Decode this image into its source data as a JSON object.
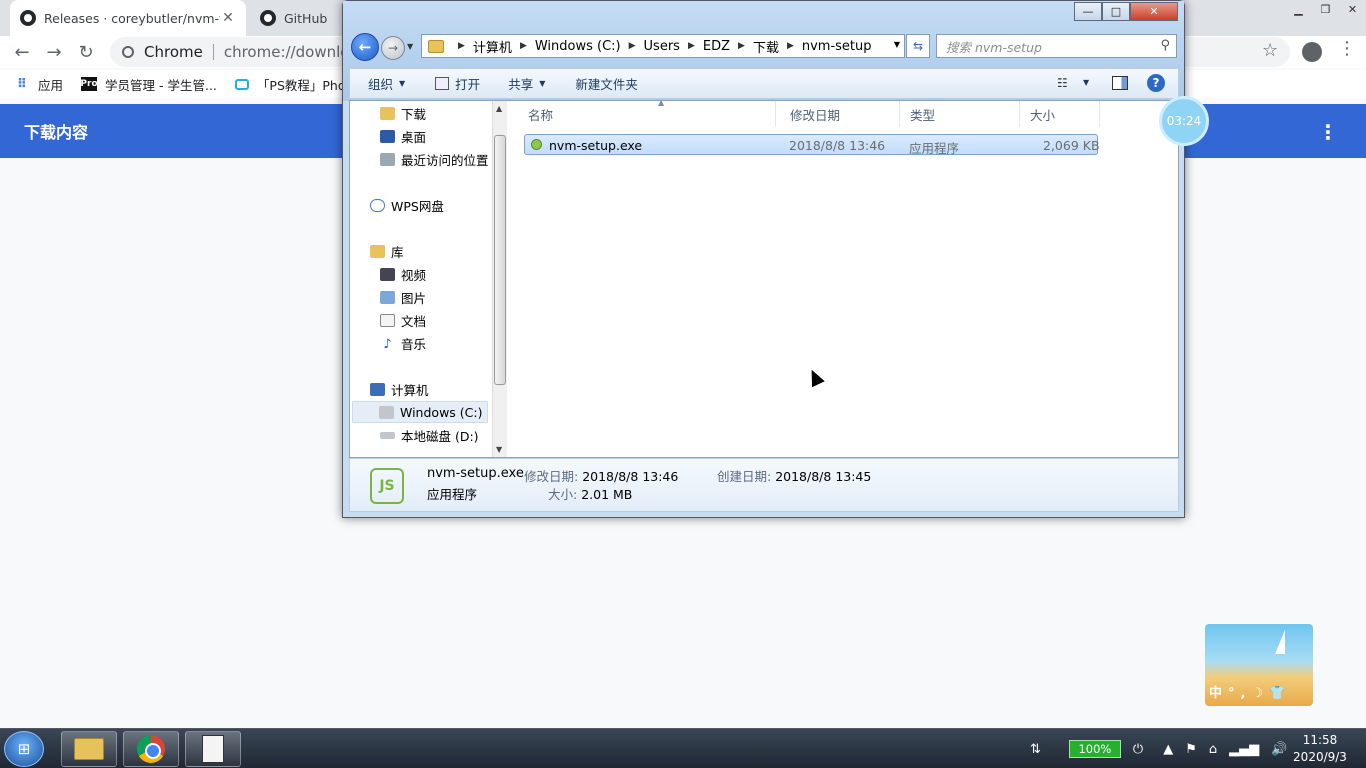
{
  "chrome": {
    "tabs": [
      {
        "title": "Releases · coreybutler/nvm-wi"
      },
      {
        "title": "GitHub - r"
      }
    ],
    "omnibox": {
      "label": "Chrome",
      "url": "chrome://downloads"
    },
    "bookmarks": [
      {
        "label": "应用",
        "icon": "apps-grid-icon"
      },
      {
        "label": "学员管理 - 学生管...",
        "icon": "pro-icon"
      },
      {
        "label": "「PS教程」Pho",
        "icon": "bilibili-icon"
      }
    ],
    "downloads_title": "下载内容"
  },
  "explorer": {
    "window_controls": {
      "min": "—",
      "max": "□",
      "close": "✕"
    },
    "breadcrumb": [
      "计算机",
      "Windows (C:)",
      "Users",
      "EDZ",
      "下载",
      "nvm-setup"
    ],
    "search_placeholder": "搜索 nvm-setup",
    "commands": {
      "organize": "组织",
      "open": "打开",
      "share": "共享",
      "new_folder": "新建文件夹"
    },
    "nav": {
      "downloads": "下载",
      "desktop": "桌面",
      "recent": "最近访问的位置",
      "wps": "WPS网盘",
      "library": "库",
      "video": "视频",
      "pictures": "图片",
      "documents": "文档",
      "music": "音乐",
      "computer": "计算机",
      "drive_c": "Windows (C:)",
      "drive_d": "本地磁盘 (D:)"
    },
    "columns": {
      "name": "名称",
      "modified": "修改日期",
      "type": "类型",
      "size": "大小"
    },
    "files": [
      {
        "name": "nvm-setup.exe",
        "modified": "2018/8/8 13:46",
        "type": "应用程序",
        "size": "2,069 KB"
      }
    ],
    "details": {
      "name": "nvm-setup.exe",
      "type": "应用程序",
      "modified_label": "修改日期:",
      "modified": "2018/8/8 13:46",
      "created_label": "创建日期:",
      "created": "2018/8/8 13:45",
      "size_label": "大小:",
      "size": "2.01 MB"
    }
  },
  "timer": "03:24",
  "ime_widget": {
    "text": "中°,☽👕"
  },
  "taskbar": {
    "battery": "100%",
    "time": "11:58",
    "date": "2020/9/3"
  }
}
